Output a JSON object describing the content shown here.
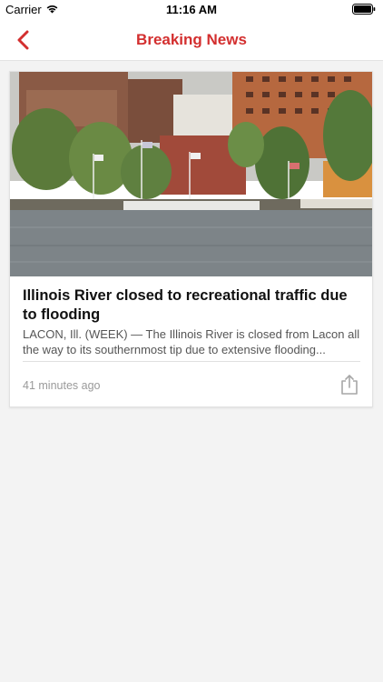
{
  "status_bar": {
    "carrier": "Carrier",
    "time": "11:16 AM",
    "wifi_icon": "wifi-icon",
    "battery_icon": "battery-icon"
  },
  "nav": {
    "title": "Breaking News",
    "back_icon": "chevron-left-icon",
    "accent_color": "#d32f2f"
  },
  "article": {
    "headline": "Illinois River closed to recreational traffic due to flooding",
    "summary": "LACON, Ill. (WEEK) — The Illinois River is closed from Lacon all the way to its southernmost tip due to extensive flooding...",
    "timestamp": "41 minutes ago",
    "share_icon": "share-icon"
  }
}
